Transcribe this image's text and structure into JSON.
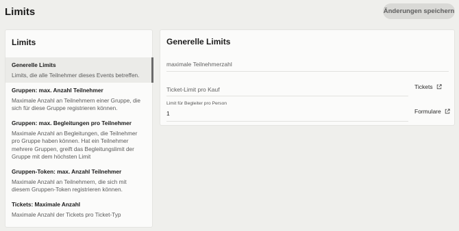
{
  "header": {
    "title": "Limits",
    "save_label": "Änderungen speichern"
  },
  "sidebar": {
    "title": "Limits",
    "items": [
      {
        "title": "Generelle Limits",
        "description": "Limits, die alle Teilnehmer dieses Events betreffen."
      },
      {
        "title": "Gruppen: max. Anzahl Teilnehmer",
        "description": "Maximale Anzahl an Teilnehmern einer Gruppe, die sich für diese Gruppe registrieren können."
      },
      {
        "title": "Gruppen: max. Begleitungen pro Teilnehmer",
        "description": "Maximale Anzahl an Begleitungen, die Teilnehmer pro Gruppe haben können. Hat ein Teilnehmer mehrere Gruppen, greift das Begleitungslimit der Gruppe mit dem höchsten Limit"
      },
      {
        "title": "Gruppen-Token: max. Anzahl Teilnehmer",
        "description": "Maximale Anzahl an Teilnehmern, die sich mit diesem Gruppen-Token registrieren können."
      },
      {
        "title": "Tickets: Maximale Anzahl",
        "description": "Maximale Anzahl der Tickets pro Ticket-Typ"
      }
    ],
    "active_index": 0
  },
  "main": {
    "title": "Generelle Limits",
    "fields": {
      "max_participants": {
        "placeholder": "maximale Teilnehmerzahl",
        "value": ""
      },
      "ticket_limit": {
        "placeholder": "Ticket-Limit pro Kauf",
        "value": ""
      },
      "companion_limit": {
        "label": "Limit für Begleiter pro Person",
        "value": "1"
      }
    },
    "links": {
      "tickets": "Tickets",
      "forms": "Formulare"
    }
  },
  "icons": {
    "external_link": "external-link-icon"
  },
  "colors": {
    "background": "#efefec",
    "card": "#fbfbfa",
    "active_indicator": "#6a6a6a",
    "save_button_bg": "#d9d9d6"
  }
}
